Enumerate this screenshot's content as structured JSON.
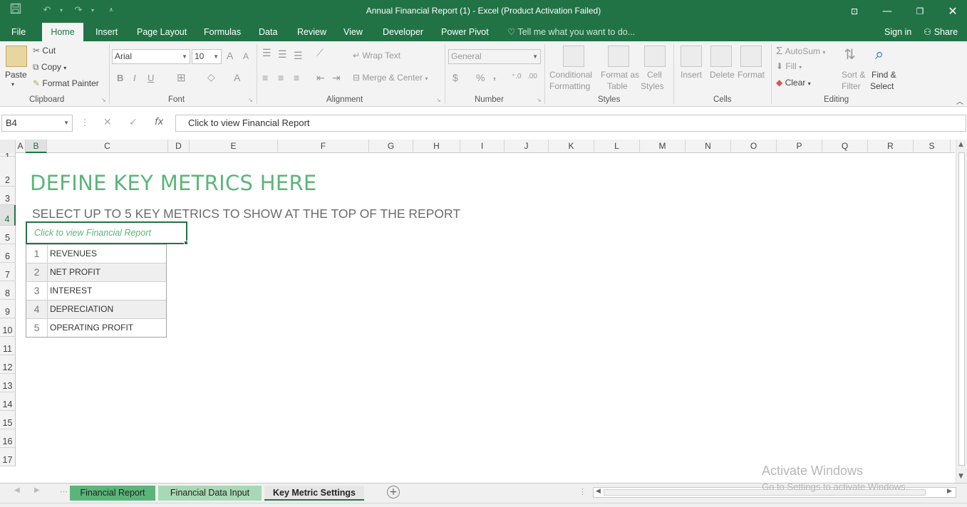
{
  "titlebar": {
    "title": "Annual Financial Report (1) - Excel (Product Activation Failed)",
    "save_icon": "save-icon",
    "undo_icon": "undo-icon",
    "redo_icon": "redo-icon",
    "customize_icon": "customize-qat-icon",
    "ribbon_display_icon": "ribbon-display-icon",
    "minimize_icon": "minimize-icon",
    "restore_icon": "restore-icon",
    "close_icon": "close-icon"
  },
  "tabs": {
    "file": "File",
    "home": "Home",
    "insert": "Insert",
    "page_layout": "Page Layout",
    "formulas": "Formulas",
    "data": "Data",
    "review": "Review",
    "view": "View",
    "developer": "Developer",
    "power_pivot": "Power Pivot",
    "tell_me": "Tell me what you want to do...",
    "sign_in": "Sign in",
    "share": "Share"
  },
  "ribbon": {
    "clipboard": {
      "paste": "Paste",
      "cut": "Cut",
      "copy": "Copy",
      "format_painter": "Format Painter",
      "label": "Clipboard"
    },
    "font": {
      "font_name": "Arial",
      "font_size": "10",
      "grow": "A",
      "shrink": "A",
      "bold": "B",
      "italic": "I",
      "underline": "U",
      "font_color": "A",
      "label": "Font"
    },
    "alignment": {
      "wrap_text": "Wrap Text",
      "merge_center": "Merge & Center",
      "label": "Alignment"
    },
    "number": {
      "format": "General",
      "currency": "$",
      "percent": "%",
      "comma": ",",
      "label": "Number"
    },
    "styles": {
      "conditional_1": "Conditional",
      "conditional_2": "Formatting",
      "format_as_1": "Format as",
      "format_as_2": "Table",
      "cell_styles_1": "Cell",
      "cell_styles_2": "Styles",
      "label": "Styles"
    },
    "cells": {
      "insert": "Insert",
      "delete": "Delete",
      "format": "Format",
      "label": "Cells"
    },
    "editing": {
      "autosum": "AutoSum",
      "fill": "Fill",
      "clear": "Clear",
      "sort_1": "Sort &",
      "sort_2": "Filter",
      "find_1": "Find &",
      "find_2": "Select",
      "label": "Editing"
    }
  },
  "formula_bar": {
    "name_box": "B4",
    "cancel": "✕",
    "enter": "✓",
    "fx": "fx",
    "formula": "Click to view Financial Report"
  },
  "columns": [
    "A",
    "B",
    "C",
    "D",
    "E",
    "F",
    "G",
    "H",
    "I",
    "J",
    "K",
    "L",
    "M",
    "N",
    "O",
    "P",
    "Q",
    "R",
    "S"
  ],
  "rows": [
    "1",
    "2",
    "3",
    "4",
    "5",
    "6",
    "7",
    "8",
    "9",
    "10",
    "11",
    "12",
    "13",
    "14",
    "15",
    "16",
    "17"
  ],
  "sheet": {
    "heading": "DEFINE KEY METRICS HERE",
    "subheading": "SELECT UP TO 5 KEY METRICS TO SHOW AT THE TOP OF THE REPORT",
    "selected_cell_text": "Click to view Financial Report",
    "metrics": [
      {
        "num": "1",
        "label": "REVENUES"
      },
      {
        "num": "2",
        "label": "NET PROFIT"
      },
      {
        "num": "3",
        "label": "INTEREST"
      },
      {
        "num": "4",
        "label": "DEPRECIATION"
      },
      {
        "num": "5",
        "label": "OPERATING PROFIT"
      }
    ]
  },
  "sheet_tabs": [
    {
      "label": "Financial Report",
      "color": "#5bb57a"
    },
    {
      "label": "Financial Data Input",
      "color": "#a9d8b5"
    },
    {
      "label": "Key Metric Settings",
      "color": "#e6e6e6"
    }
  ],
  "watermark": {
    "line1": "Activate Windows",
    "line2": "Go to Settings to activate Windows."
  },
  "colors": {
    "excel_green": "#217346",
    "heading_green": "#5bb57a"
  }
}
